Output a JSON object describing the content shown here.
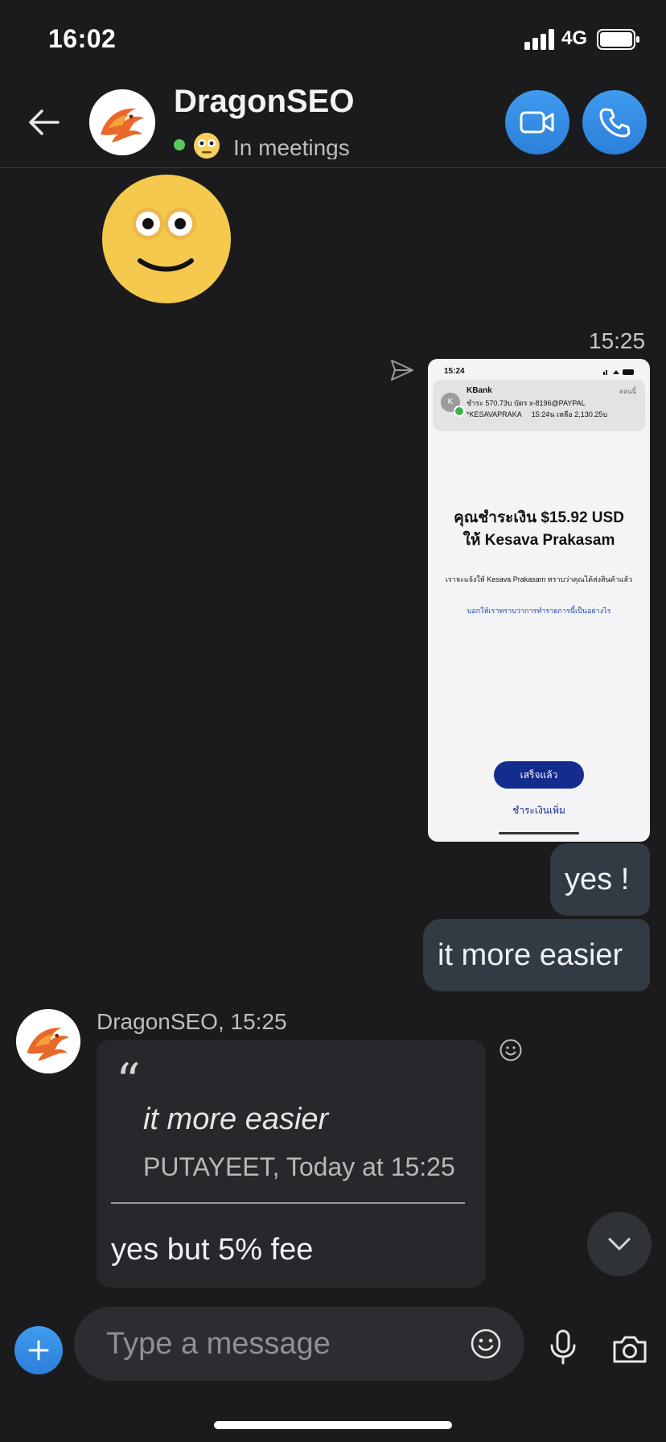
{
  "status_bar": {
    "time": "16:02",
    "network": "4G"
  },
  "header": {
    "contact_name": "DragonSEO",
    "presence": "In meetings"
  },
  "conversation": {
    "outgoing_time": "15:25",
    "shared_screenshot": {
      "time": "15:24",
      "notif_app": "KBank",
      "notif_when": "ตอนนี้",
      "notif_line1": "ชำระ 570.73บ บัตร x-8196@PAYPAL",
      "notif_line2": "*KESAVAPRAKA     15:24น เหลือ 2,130.25บ",
      "heading_line1": "คุณชำระเงิน $15.92 USD",
      "heading_line2": "ให้ Kesava Prakasam",
      "body": "เราจะแจ้งให้ Kesava Prakasam ทราบว่าคุณได้ส่งสินค้าแล้ว",
      "link": "บอกให้เราทราบว่าการทำรายการนี้เป็นอย่างไร",
      "done_button": "เสร็จแล้ว",
      "pay_more": "ชำระเงินเพิ่ม"
    },
    "outgoing_messages": [
      "yes !",
      "it more easier"
    ],
    "incoming": {
      "meta": "DragonSEO, 15:25",
      "quote_text": "it more easier",
      "quote_author": "PUTAYEET, Today at 15:25",
      "reply": "yes but 5% fee"
    }
  },
  "composer": {
    "placeholder": "Type a message"
  },
  "colors": {
    "accent": "#3f9bf0",
    "bubble_out": "#323a44",
    "bubble_in": "#26282b",
    "background": "#1b1b1d"
  }
}
